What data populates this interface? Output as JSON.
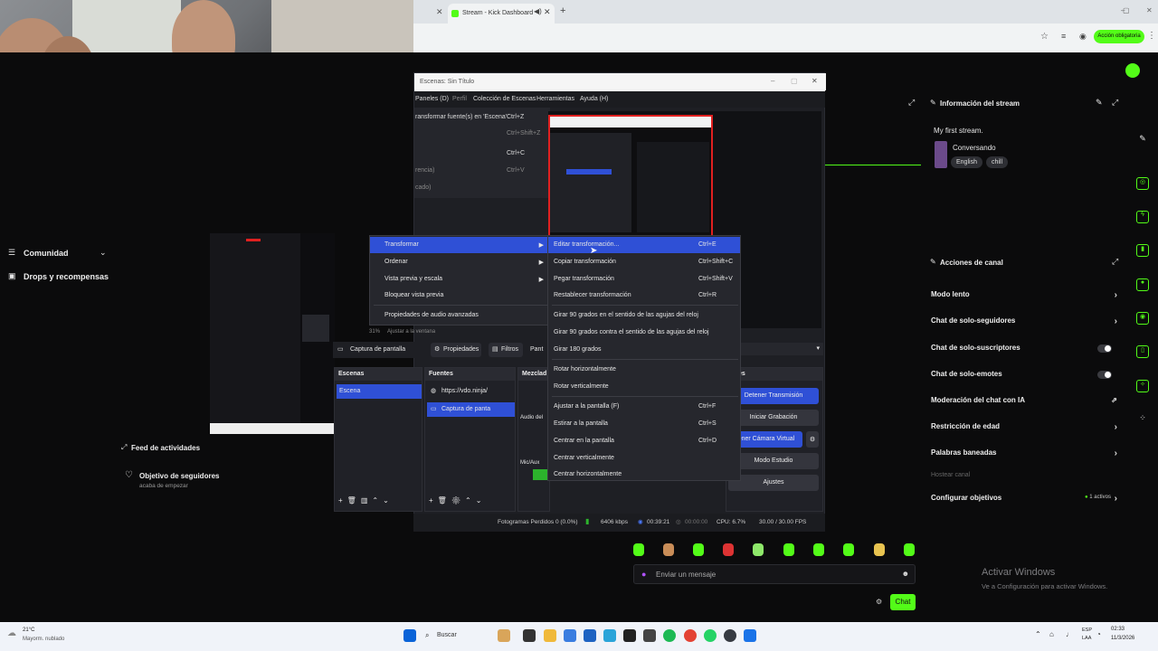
{
  "browser": {
    "tab_title": "Stream - Kick Dashboard",
    "action_pill": "Acción obligatoria"
  },
  "sidebar": {
    "items": [
      {
        "label": "Comunidad"
      },
      {
        "label": "Drops y recompensas"
      }
    ]
  },
  "obs": {
    "title": "Escenas: Sin Título",
    "menu": [
      "Paneles (D)",
      "Perfil",
      "Colección de Escenas",
      "Herramientas",
      "Ayuda (H)"
    ],
    "edit_menu": [
      {
        "label": "ransformar fuente(s) en 'Escena'",
        "shortcut": "Ctrl+Z"
      },
      {
        "label": "",
        "shortcut": "Ctrl+Shift+Z"
      },
      {
        "label": "",
        "shortcut": "Ctrl+C"
      },
      {
        "label": "rencia)",
        "shortcut": "Ctrl+V"
      },
      {
        "label": "cado)",
        "shortcut": ""
      }
    ],
    "context_menu": [
      {
        "label": "Transformar",
        "highlighted": true
      },
      {
        "label": "Ordenar"
      },
      {
        "label": "Vista previa y escala"
      },
      {
        "label": "Bloquear vista previa"
      },
      {
        "label": "Propiedades de audio avanzadas"
      }
    ],
    "transform_menu": [
      {
        "label": "Editar transformación...",
        "shortcut": "Ctrl+E",
        "highlighted": true
      },
      {
        "label": "Copiar transformación",
        "shortcut": "Ctrl+Shift+C"
      },
      {
        "label": "Pegar transformación",
        "shortcut": "Ctrl+Shift+V"
      },
      {
        "label": "Restablecer transformación",
        "shortcut": "Ctrl+R"
      },
      {
        "label": "Girar 90 grados en el sentido de las agujas del reloj",
        "shortcut": ""
      },
      {
        "label": "Girar 90 grados contra el sentido de las agujas del reloj",
        "shortcut": ""
      },
      {
        "label": "Girar 180 grados",
        "shortcut": ""
      },
      {
        "label": "Rotar horizontalmente",
        "shortcut": ""
      },
      {
        "label": "Rotar verticalmente",
        "shortcut": ""
      },
      {
        "label": "Ajustar a la pantalla (F)",
        "shortcut": "Ctrl+F"
      },
      {
        "label": "Estirar a la pantalla",
        "shortcut": "Ctrl+S"
      },
      {
        "label": "Centrar en la pantalla",
        "shortcut": "Ctrl+D"
      },
      {
        "label": "Centrar verticalmente",
        "shortcut": ""
      },
      {
        "label": "Centrar horizontalmente",
        "shortcut": ""
      }
    ],
    "zoom": "31%",
    "fit_label": "Ajustar a la ventana",
    "source_toolbar": {
      "source": "Captura de pantalla",
      "properties": "Propiedades",
      "filters": "Filtros",
      "more": "Pant"
    },
    "scenes": {
      "header": "Escenas",
      "items": [
        "Escena"
      ]
    },
    "sources": {
      "header": "Fuentes",
      "items": [
        "https://vdo.ninja/",
        "Captura de panta"
      ]
    },
    "mixer": {
      "header": "Mezclad",
      "items": [
        "Audio del",
        "Mic/Aux"
      ]
    },
    "controls": {
      "header": "roles",
      "buttons": [
        "Detener Transmisión",
        "Iniciar Grabación",
        "tener Cámara Virtual",
        "Modo Estudio",
        "Ajustes"
      ]
    },
    "status": {
      "dropped": "Fotogramas Perdidos 0 (0.0%)",
      "bitrate": "6406 kbps",
      "live_time": "00:39:21",
      "rec_time": "00:00:00",
      "cpu": "CPU: 6.7%",
      "fps": "30.00 / 30.00 FPS"
    }
  },
  "activity": {
    "header": "Feed de actividades",
    "item_title": "Objetivo de seguidores",
    "item_sub": "acaba de empezar"
  },
  "stream_info": {
    "header": "Información del stream",
    "title": "My first stream.",
    "category": "Conversando",
    "tags": [
      "English",
      "chill"
    ]
  },
  "channel_actions": {
    "header": "Acciones de canal",
    "items": [
      {
        "label": "Modo lento",
        "control": "chevron"
      },
      {
        "label": "Chat de solo-seguidores",
        "control": "chevron"
      },
      {
        "label": "Chat de solo-suscriptores",
        "control": "toggle"
      },
      {
        "label": "Chat de solo-emotes",
        "control": "toggle"
      },
      {
        "label": "Moderación del chat con IA",
        "control": "link"
      },
      {
        "label": "Restricción de edad",
        "control": "chevron"
      },
      {
        "label": "Palabras baneadas",
        "control": "chevron"
      }
    ],
    "host_label": "Hostear canal",
    "goals": {
      "label": "Configurar objetivos",
      "status": "1 activos"
    }
  },
  "chat": {
    "placeholder": "Enviar un mensaje",
    "send_label": "Chat"
  },
  "watermark": {
    "line1": "Activar Windows",
    "line2": "Ve a Configuración para activar Windows."
  },
  "taskbar": {
    "weather_temp": "21°C",
    "weather_desc": "Mayorm. nublado",
    "search": "Buscar",
    "lang": "ESP",
    "lang2": "LAA",
    "time": "02:33",
    "date": "11/3/2026"
  },
  "colors": {
    "kick_green": "#53fc18",
    "obs_highlight": "#2f50d6"
  }
}
